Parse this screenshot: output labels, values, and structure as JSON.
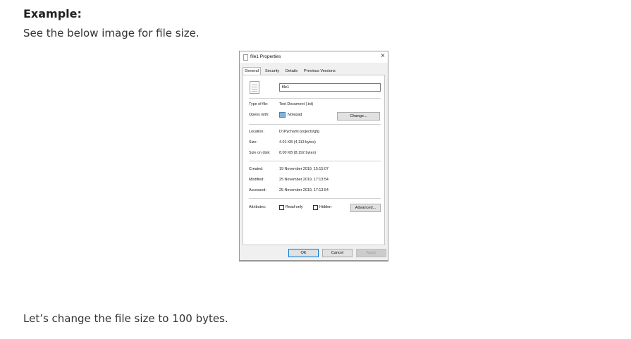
{
  "article": {
    "heading": "Example:",
    "intro": "See the below image for file size.",
    "followup": "Let’s change the file size to 100 bytes."
  },
  "dialog": {
    "title": "file1 Properties",
    "close_glyph": "×",
    "tabs": [
      "General",
      "Security",
      "Details",
      "Previous Versions"
    ],
    "file_name": "file1",
    "type_label": "Type of file:",
    "type_value": "Text Document (.txt)",
    "opens_label": "Opens with:",
    "opens_value": "Notepad",
    "change_button": "Change...",
    "location_label": "Location:",
    "location_value": "D:\\Pychami projects\\gfg",
    "size_label": "Size:",
    "size_value": "4.01 KB (4,113 bytes)",
    "size_disk_label": "Size on disk:",
    "size_disk_value": "8.00 KB (8,192 bytes)",
    "created_label": "Created:",
    "created_value": "19 November 2019, 15:15:07",
    "modified_label": "Modified:",
    "modified_value": "25 November 2019, 17:13:54",
    "accessed_label": "Accessed:",
    "accessed_value": "25 November 2019, 17:13:54",
    "attributes_label": "Attributes:",
    "readonly_label": "Read-only",
    "hidden_label": "Hidden",
    "advanced_button": "Advanced...",
    "ok_button": "OK",
    "cancel_button": "Cancel",
    "apply_button": "Apply"
  }
}
